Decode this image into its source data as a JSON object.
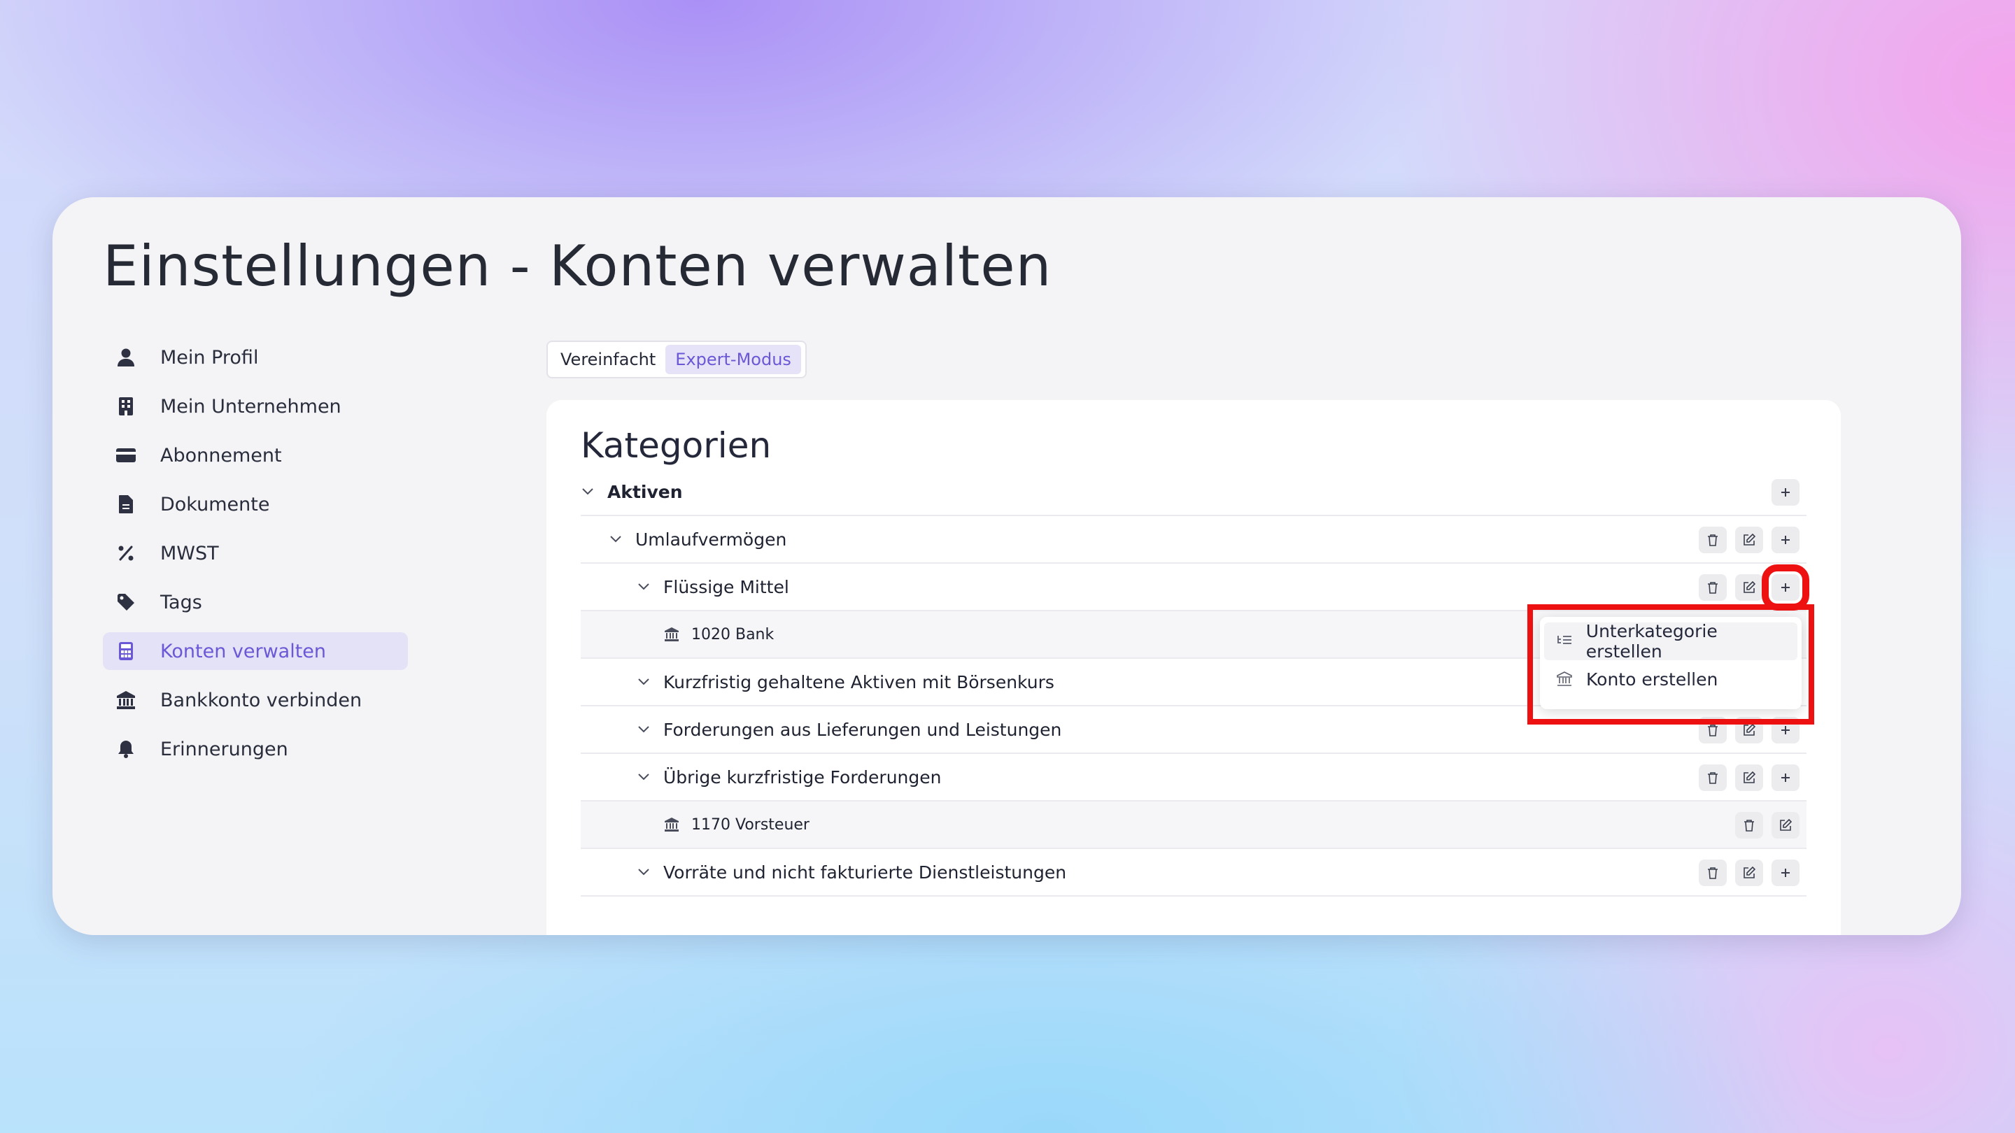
{
  "page_title": "Einstellungen - Konten verwalten",
  "sidebar": {
    "items": [
      {
        "label": "Mein Profil",
        "icon": "user-icon"
      },
      {
        "label": "Mein Unternehmen",
        "icon": "building-icon"
      },
      {
        "label": "Abonnement",
        "icon": "credit-card-icon"
      },
      {
        "label": "Dokumente",
        "icon": "document-icon"
      },
      {
        "label": "MWST",
        "icon": "percent-icon"
      },
      {
        "label": "Tags",
        "icon": "tag-icon"
      },
      {
        "label": "Konten verwalten",
        "icon": "calculator-icon",
        "active": true
      },
      {
        "label": "Bankkonto verbinden",
        "icon": "bank-icon"
      },
      {
        "label": "Erinnerungen",
        "icon": "bell-icon"
      }
    ]
  },
  "mode_toggle": {
    "simple": "Vereinfacht",
    "expert": "Expert-Modus",
    "selected": "Expert-Modus"
  },
  "panel": {
    "title": "Kategorien",
    "rows": [
      {
        "label": "Aktiven",
        "type": "category",
        "level": 0,
        "actions": [
          "add"
        ]
      },
      {
        "label": "Umlaufvermögen",
        "type": "category",
        "level": 1,
        "actions": [
          "delete",
          "edit",
          "add"
        ]
      },
      {
        "label": "Flüssige Mittel",
        "type": "category",
        "level": 2,
        "actions": [
          "delete",
          "edit",
          "add"
        ]
      },
      {
        "label": "1020 Bank",
        "type": "account",
        "level": 3,
        "actions": []
      },
      {
        "label": "Kurzfristig gehaltene Aktiven mit Börsenkurs",
        "type": "category",
        "level": 2,
        "actions": []
      },
      {
        "label": "Forderungen aus Lieferungen und Leistungen",
        "type": "category",
        "level": 2,
        "actions": [
          "delete",
          "edit",
          "add"
        ]
      },
      {
        "label": "Übrige kurzfristige Forderungen",
        "type": "category",
        "level": 2,
        "actions": [
          "delete",
          "edit",
          "add"
        ]
      },
      {
        "label": "1170 Vorsteuer",
        "type": "account",
        "level": 3,
        "actions": [
          "delete",
          "edit"
        ]
      },
      {
        "label": "Vorräte und nicht fakturierte Dienstleistungen",
        "type": "category",
        "level": 2,
        "actions": [
          "delete",
          "edit",
          "add"
        ]
      }
    ]
  },
  "dropdown": {
    "items": [
      {
        "label": "Unterkategorie erstellen",
        "icon": "subcategory-icon"
      },
      {
        "label": "Konto erstellen",
        "icon": "bank-icon"
      }
    ]
  },
  "colors": {
    "accent": "#6a58d6",
    "highlight": "#ee1111",
    "active_bg": "#e4e2f6"
  }
}
